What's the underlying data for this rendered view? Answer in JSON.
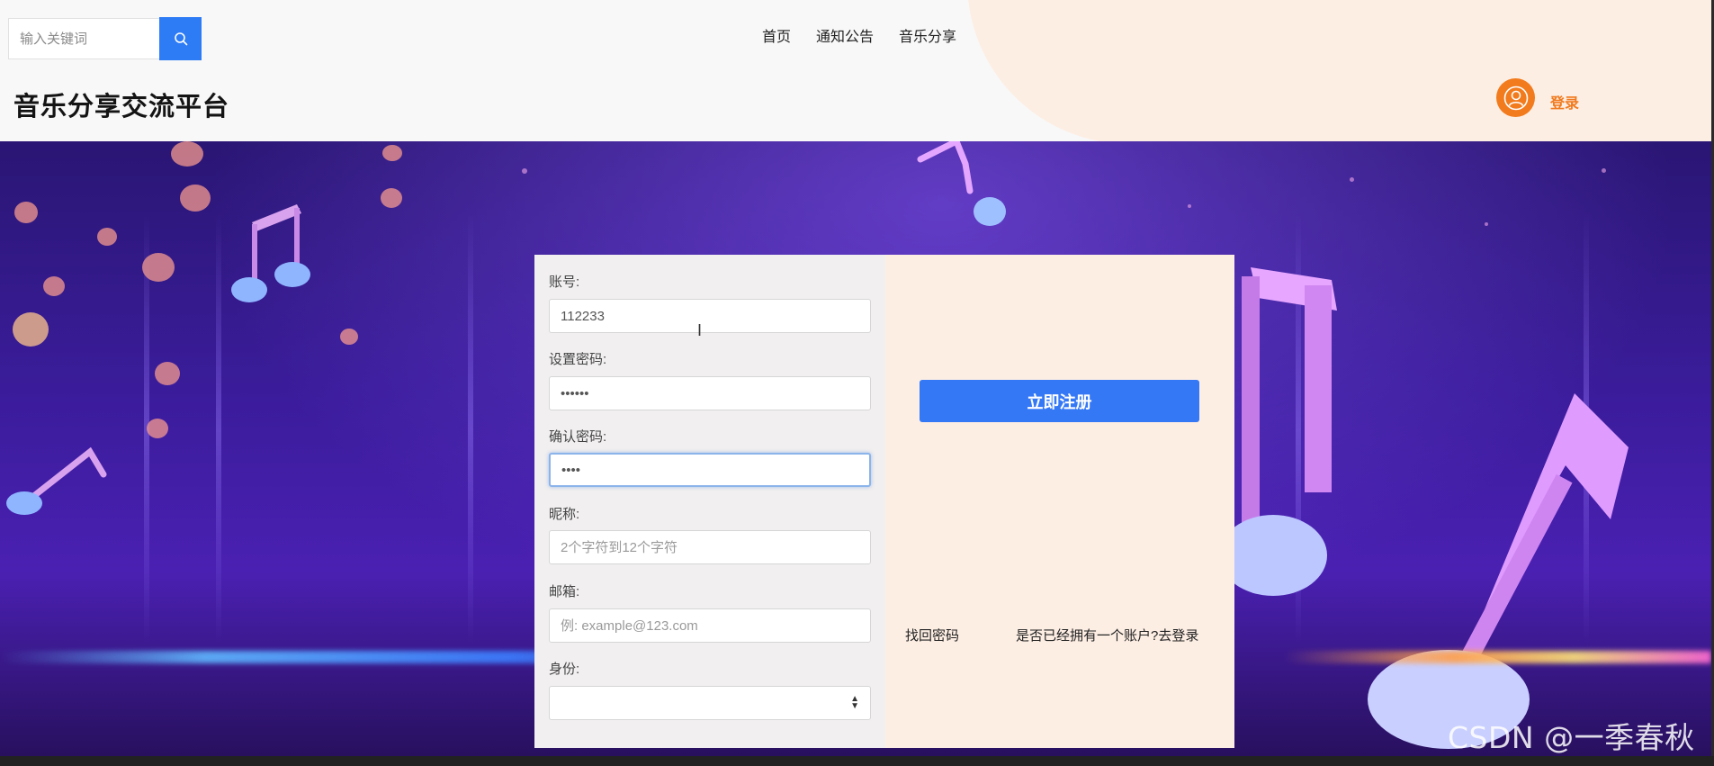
{
  "header": {
    "search": {
      "placeholder": "输入关键词",
      "value": ""
    },
    "nav": [
      "首页",
      "通知公告",
      "音乐分享"
    ],
    "site_title": "音乐分享交流平台",
    "login_label": "登录",
    "colors": {
      "accent": "#2d7cf6",
      "login": "#f07a1e"
    }
  },
  "icons": {
    "search": "search-icon",
    "user": "user-avatar-icon"
  },
  "form": {
    "account": {
      "label": "账号:",
      "value": "112233"
    },
    "password": {
      "label": "设置密码:",
      "value": "••••••"
    },
    "confirm_password": {
      "label": "确认密码:",
      "value": "••••"
    },
    "nickname": {
      "label": "昵称:",
      "placeholder": "2个字符到12个字符",
      "value": ""
    },
    "email": {
      "label": "邮箱:",
      "placeholder": "例: example@123.com",
      "value": ""
    },
    "role": {
      "label": "身份:",
      "selected": ""
    },
    "register_button": "立即注册",
    "forgot_password": "找回密码",
    "have_account": "是否已经拥有一个账户?去登录"
  },
  "watermark": "CSDN @一季春秋"
}
